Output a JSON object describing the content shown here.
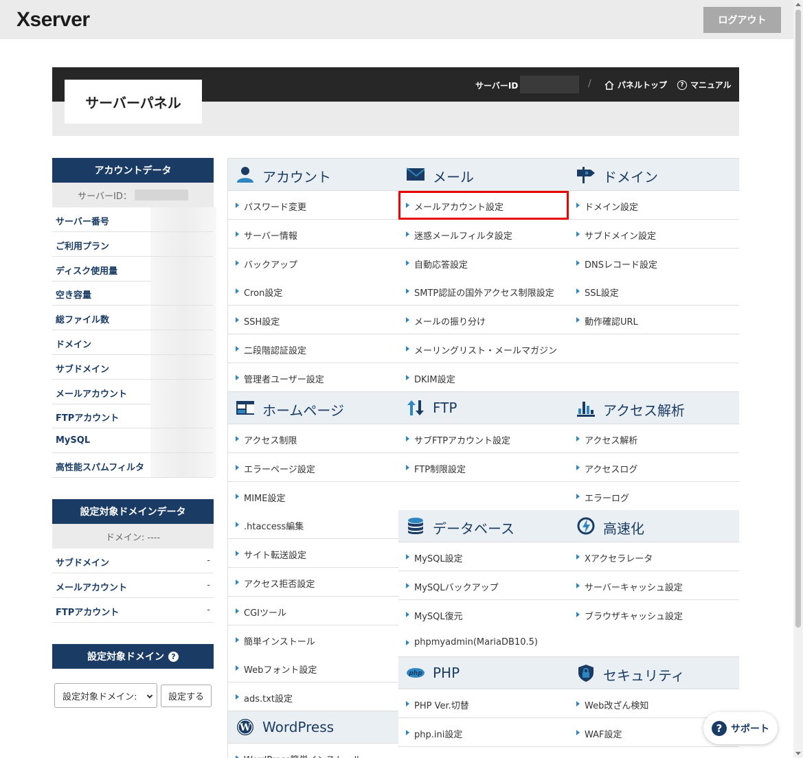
{
  "header": {
    "logo": "Xserver",
    "logout": "ログアウト"
  },
  "panel": {
    "title": "サーバーパネル",
    "server_id_label": "サーバーID",
    "slash": "/",
    "panel_top": "パネルトップ",
    "manual": "マニュアル"
  },
  "sidebar": {
    "account_head": "アカウントデータ",
    "account_sub_label": "サーバーID：",
    "account_rows": [
      {
        "k": "サーバー番号"
      },
      {
        "k": "ご利用プラン"
      },
      {
        "k": "ディスク使用量"
      },
      {
        "k": "空き容量"
      },
      {
        "k": "総ファイル数"
      },
      {
        "k": "ドメイン"
      },
      {
        "k": "サブドメイン"
      },
      {
        "k": "メールアカウント"
      },
      {
        "k": "FTPアカウント"
      },
      {
        "k": "MySQL"
      },
      {
        "k": "高性能スパムフィルタ"
      }
    ],
    "domain_head": "設定対象ドメインデータ",
    "domain_sub": "ドメイン: ----",
    "domain_rows": [
      {
        "k": "サブドメイン",
        "v": "-"
      },
      {
        "k": "メールアカウント",
        "v": "-"
      },
      {
        "k": "FTPアカウント",
        "v": "-"
      }
    ],
    "target_head": "設定対象ドメイン",
    "select_value": "設定対象ドメイン:",
    "set_button": "設定する"
  },
  "menu": {
    "account": {
      "title": "アカウント",
      "items": [
        "パスワード変更",
        "サーバー情報",
        "バックアップ",
        "Cron設定",
        "SSH設定",
        "二段階認証設定",
        "管理者ユーザー設定"
      ]
    },
    "mail": {
      "title": "メール",
      "items": [
        "メールアカウント設定",
        "迷惑メールフィルタ設定",
        "自動応答設定",
        "SMTP認証の国外アクセス制限設定",
        "メールの振り分け",
        "メーリングリスト・メールマガジン",
        "DKIM設定"
      ]
    },
    "domain": {
      "title": "ドメイン",
      "items": [
        "ドメイン設定",
        "サブドメイン設定",
        "DNSレコード設定",
        "SSL設定",
        "動作確認URL"
      ]
    },
    "homepage": {
      "title": "ホームページ",
      "items": [
        "アクセス制限",
        "エラーページ設定",
        "MIME設定",
        ".htaccess編集",
        "サイト転送設定",
        "アクセス拒否設定",
        "CGIツール",
        "簡単インストール",
        "Webフォント設定",
        "ads.txt設定"
      ]
    },
    "ftp": {
      "title": "FTP",
      "items": [
        "サブFTPアカウント設定",
        "FTP制限設定"
      ]
    },
    "analytics": {
      "title": "アクセス解析",
      "items": [
        "アクセス解析",
        "アクセスログ",
        "エラーログ"
      ]
    },
    "database": {
      "title": "データベース",
      "items": [
        "MySQL設定",
        "MySQLバックアップ",
        "MySQL復元",
        "phpmyadmin(MariaDB10.5)"
      ]
    },
    "speed": {
      "title": "高速化",
      "items": [
        "Xアクセラレータ",
        "サーバーキャッシュ設定",
        "ブラウザキャッシュ設定"
      ]
    },
    "php": {
      "title": "PHP",
      "items": [
        "PHP Ver.切替",
        "php.ini設定"
      ]
    },
    "security": {
      "title": "セキュリティ",
      "items": [
        "Web改ざん検知",
        "WAF設定"
      ]
    },
    "wordpress": {
      "title": "WordPress",
      "items": [
        "WordPress簡単インストール"
      ]
    }
  },
  "support": "サポート",
  "colors": {
    "navy": "#1a3c64",
    "highlight": "#e60000",
    "bullet": "#2e86c1"
  }
}
